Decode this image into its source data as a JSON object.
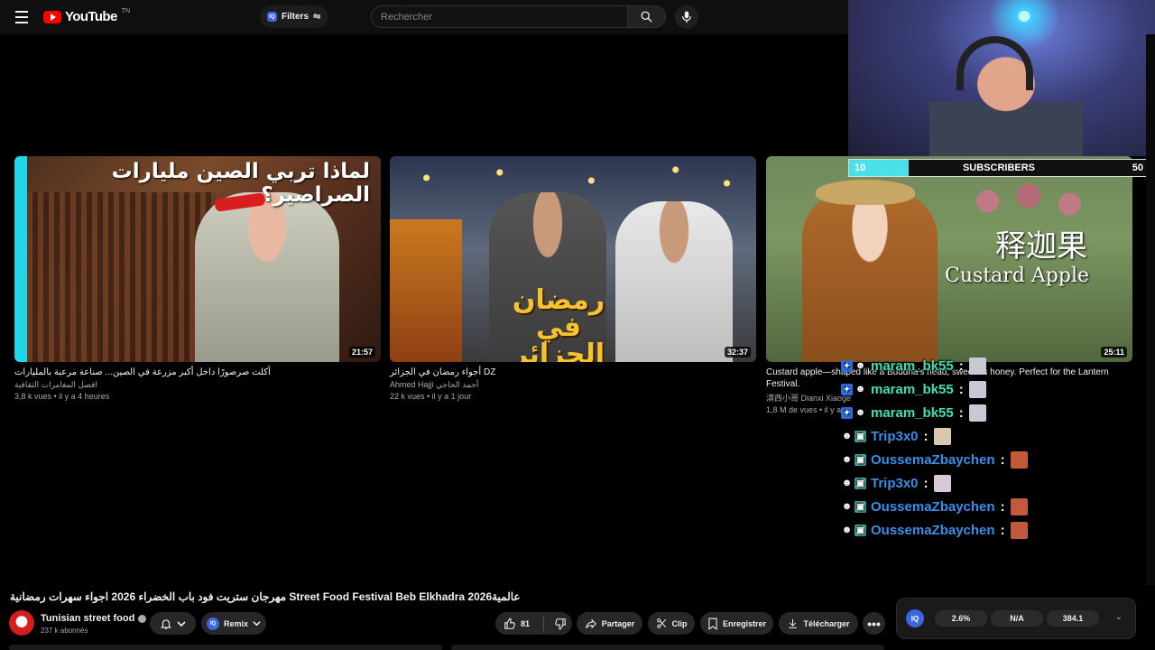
{
  "header": {
    "logo_text": "YouTube",
    "logo_sup": "TN",
    "filters_label": "Filters",
    "iq_label": "IQ",
    "search_placeholder": "Rechercher"
  },
  "videos": [
    {
      "thumb_text": "لماذا تربي الصين مليارات الصراصير؟",
      "duration": "21:57",
      "title": "أكلت صرصورًا داخل أكبر مزرعة في الصين... صناعة مرعبة بالمليارات",
      "channel": "افضل المغامرات الثقافية",
      "meta": "3,8 k vues • il y a 4 heures",
      "bar_color": "#20d6e8"
    },
    {
      "thumb_text": "رمضان في الجزائر",
      "duration": "32:37",
      "title": "أجواء رمضان في الجزائر DZ",
      "channel": "Ahmed Hajji أحمد الحاجي",
      "meta": "22 k vues • il y a 1 jour"
    },
    {
      "thumb_text_cn": "释迦果",
      "thumb_text_en": "Custard Apple",
      "duration": "25:11",
      "title": "Custard apple—shaped like a Buddha's head, sweet as honey. Perfect for the Lantern Festival.",
      "channel": "滇西小哥 Dianxi Xiaoge",
      "meta": "1,8 M de vues • il y a"
    }
  ],
  "subscriber_goal": {
    "min": "10",
    "label": "SUBSCRIBERS",
    "max": "50",
    "progress_fraction": 0.2,
    "bar_color": "#4be0e8"
  },
  "chat": [
    {
      "name": "maram_bk55",
      "color": "#3fe0b0",
      "badges": [
        "b1",
        "face"
      ],
      "emote_color": "#c9c9d6"
    },
    {
      "name": "maram_bk55",
      "color": "#3fe0b0",
      "badges": [
        "b1",
        "face"
      ],
      "emote_color": "#c9c9d6"
    },
    {
      "name": "maram_bk55",
      "color": "#3fe0b0",
      "badges": [
        "b1",
        "face"
      ],
      "emote_color": "#c9c9d6"
    },
    {
      "name": "Trip3x0",
      "color": "#3a8ee8",
      "badges": [
        "face",
        "b2"
      ],
      "emote_color": "#d8c8b0"
    },
    {
      "name": "OussemaZbaychen",
      "color": "#3a8ee8",
      "badges": [
        "face",
        "b2"
      ],
      "emote_color": "#c05a3a"
    },
    {
      "name": "Trip3x0",
      "color": "#3a8ee8",
      "badges": [
        "face",
        "b2"
      ],
      "emote_color": "#d8c8d8"
    },
    {
      "name": "OussemaZbaychen",
      "color": "#3a8ee8",
      "badges": [
        "face",
        "b2"
      ],
      "emote_color": "#c05a3a"
    },
    {
      "name": "OussemaZbaychen",
      "color": "#3a8ee8",
      "badges": [
        "face",
        "b2"
      ],
      "emote_color": "#c05a3a"
    }
  ],
  "chat_colon": ":",
  "watch": {
    "title": "مهرجان ستريت فود باب الخضراء 2026 اجواء سهرات رمضانية Street Food Festival Beb Elkhadra 2026عالمية",
    "channel_name": "Tunisian street food",
    "subscribers": "237 k abonnés",
    "remix_label": "Remix",
    "like_count": "81",
    "share_label": "Partager",
    "clip_label": "Clip",
    "save_label": "Enregistrer",
    "download_label": "Télécharger"
  },
  "stats": {
    "iq_label": "IQ",
    "values": [
      "2.6%",
      "N/A",
      "384.1"
    ]
  }
}
